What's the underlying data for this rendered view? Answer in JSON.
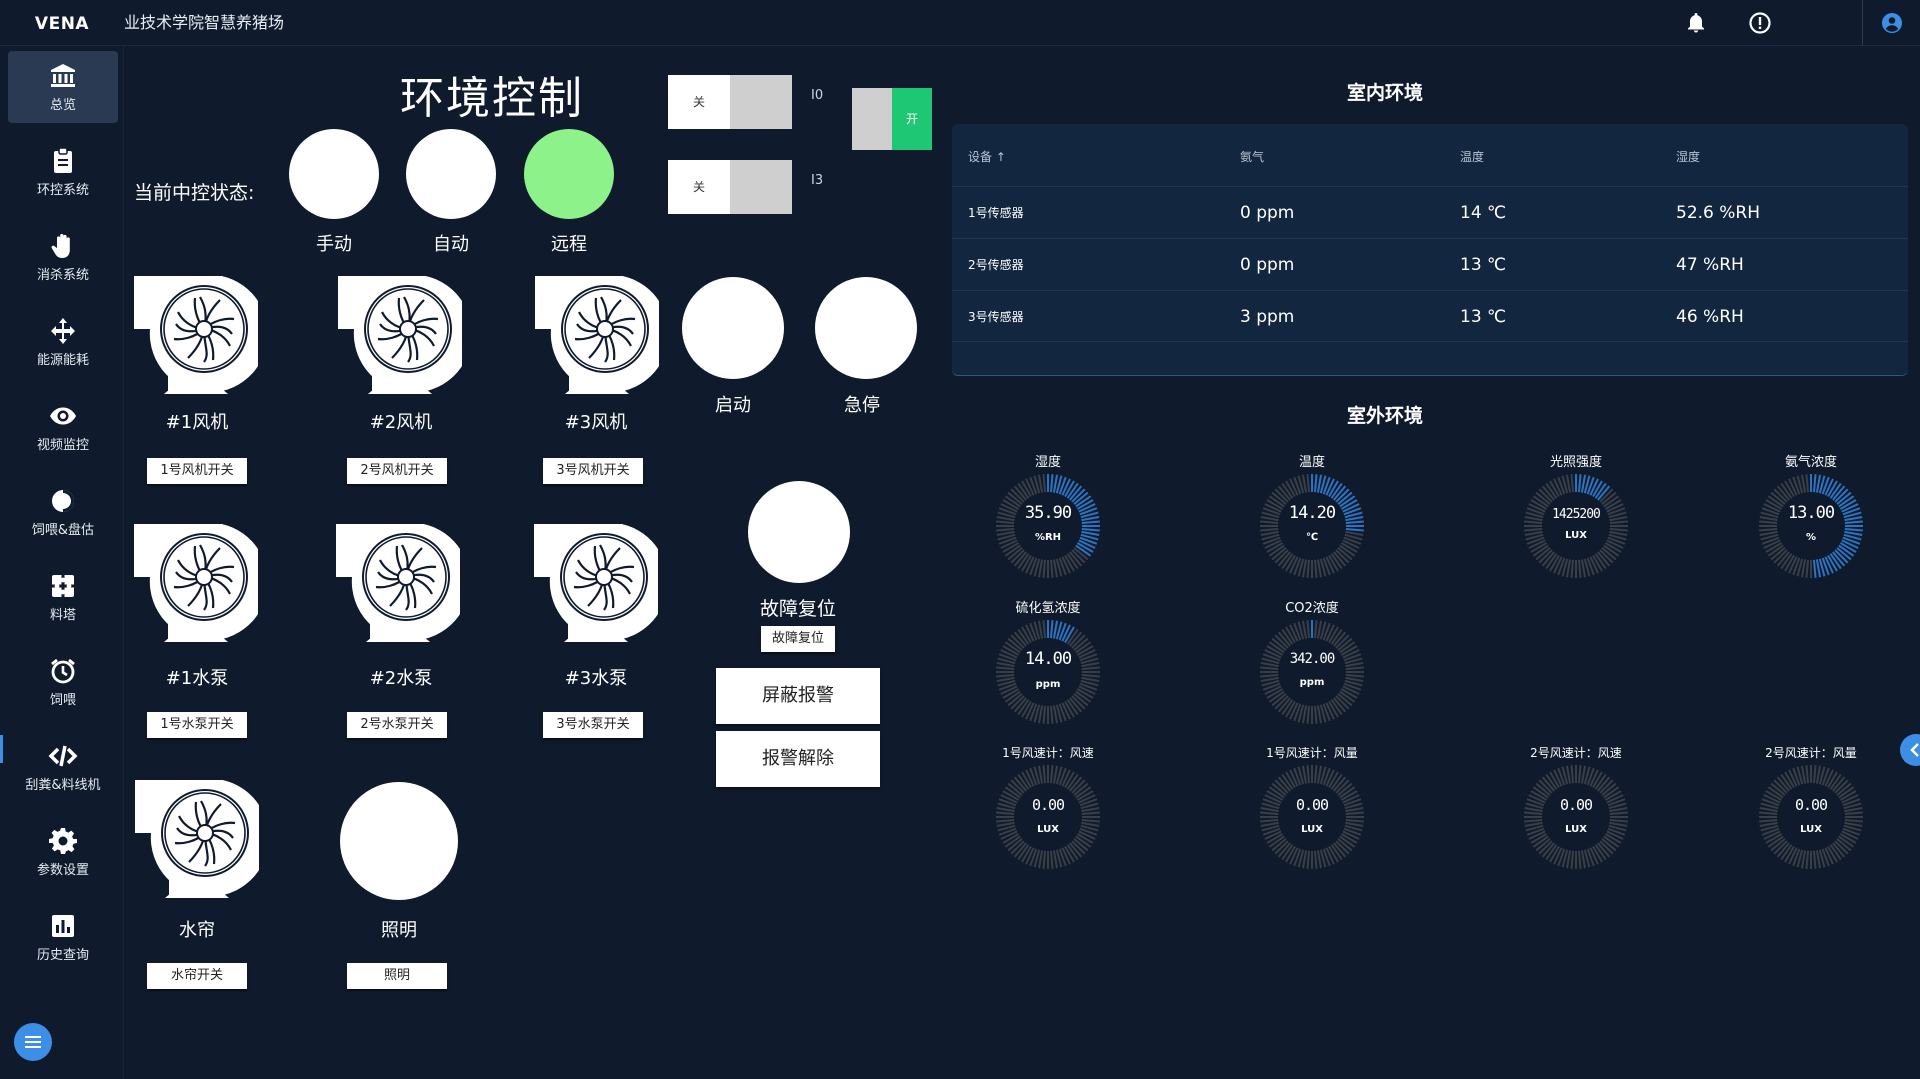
{
  "app": {
    "brand": "VENA",
    "title": "业技术学院智慧养猪场"
  },
  "colors": {
    "accent": "#3d8fe6",
    "lamp_on": "#8ef28a",
    "switch_on": "#1ec773",
    "background": "#0f1b2d"
  },
  "topbar": {
    "icons": [
      "bell-icon",
      "alert-circle-icon",
      "user-icon"
    ]
  },
  "sidebar": {
    "items": [
      {
        "label": "总览",
        "icon": "bank-icon",
        "active": true
      },
      {
        "label": "环控系统",
        "icon": "clipboard-icon"
      },
      {
        "label": "消杀系统",
        "icon": "hand-icon"
      },
      {
        "label": "能源能耗",
        "icon": "arrows-icon"
      },
      {
        "label": "视频监控",
        "icon": "eye-icon"
      },
      {
        "label": "饲喂&盘估",
        "icon": "contrast-icon"
      },
      {
        "label": "料塔",
        "icon": "puzzle-icon"
      },
      {
        "label": "饲喂",
        "icon": "alarm-icon"
      },
      {
        "label": "刮粪&料线机",
        "icon": "code-icon"
      },
      {
        "label": "参数设置",
        "icon": "gear-icon"
      },
      {
        "label": "历史查询",
        "icon": "chart-icon"
      }
    ]
  },
  "control": {
    "title": "环境控制",
    "state_label": "当前中控状态:",
    "modes": [
      {
        "label": "手动",
        "on": false
      },
      {
        "label": "自动",
        "on": false
      },
      {
        "label": "远程",
        "on": true
      }
    ],
    "toggles": [
      {
        "text": "关",
        "tag": "I0"
      },
      {
        "text": "关",
        "tag": "I3"
      }
    ],
    "switch_on": {
      "text": "开"
    },
    "devices": [
      {
        "name": "#1风机",
        "button": "1号风机开关"
      },
      {
        "name": "#2风机",
        "button": "2号风机开关"
      },
      {
        "name": "#3风机",
        "button": "3号风机开关"
      },
      {
        "name": "#1水泵",
        "button": "1号水泵开关"
      },
      {
        "name": "#2水泵",
        "button": "2号水泵开关"
      },
      {
        "name": "#3水泵",
        "button": "3号水泵开关"
      },
      {
        "name": "水帘",
        "button": "水帘开关"
      },
      {
        "name": "照明",
        "button": "照明"
      }
    ],
    "start_label": "启动",
    "estop_label": "急停",
    "fault_reset_label": "故障复位",
    "fault_reset_button": "故障复位",
    "mute_alarm_button": "屏蔽报警",
    "clear_alarm_button": "报警解除"
  },
  "indoor": {
    "title": "室内环境",
    "headers": [
      "设备 ↑",
      "氨气",
      "温度",
      "湿度"
    ],
    "rows": [
      [
        "1号传感器",
        "0 ppm",
        "14 ℃",
        "52.6 %RH"
      ],
      [
        "2号传感器",
        "0 ppm",
        "13 ℃",
        "47 %RH"
      ],
      [
        "3号传感器",
        "3 ppm",
        "13 ℃",
        "46 %RH"
      ]
    ]
  },
  "outdoor": {
    "title": "室外环境",
    "gauges": [
      {
        "title": "湿度",
        "value": "35.90",
        "unit": "%RH",
        "fraction": 0.36
      },
      {
        "title": "温度",
        "value": "14.20",
        "unit": "℃",
        "fraction": 0.28
      },
      {
        "title": "光照强度",
        "value": "1425200",
        "unit": "LUX",
        "fraction": 0.12
      },
      {
        "title": "氨气浓度",
        "value": "13.00",
        "unit": "%",
        "fraction": 0.5
      },
      {
        "title": "硫化氢浓度",
        "value": "14.00",
        "unit": "ppm",
        "fraction": 0.1
      },
      {
        "title": "CO2浓度",
        "value": "342.00",
        "unit": "ppm",
        "fraction": 0.02
      },
      {
        "title": "1号风速计：风速",
        "value": "0.00",
        "unit": "LUX",
        "fraction": 0
      },
      {
        "title": "1号风速计：风量",
        "value": "0.00",
        "unit": "LUX",
        "fraction": 0
      },
      {
        "title": "2号风速计：风速",
        "value": "0.00",
        "unit": "LUX",
        "fraction": 0
      },
      {
        "title": "2号风速计：风量",
        "value": "0.00",
        "unit": "LUX",
        "fraction": 0
      }
    ]
  }
}
